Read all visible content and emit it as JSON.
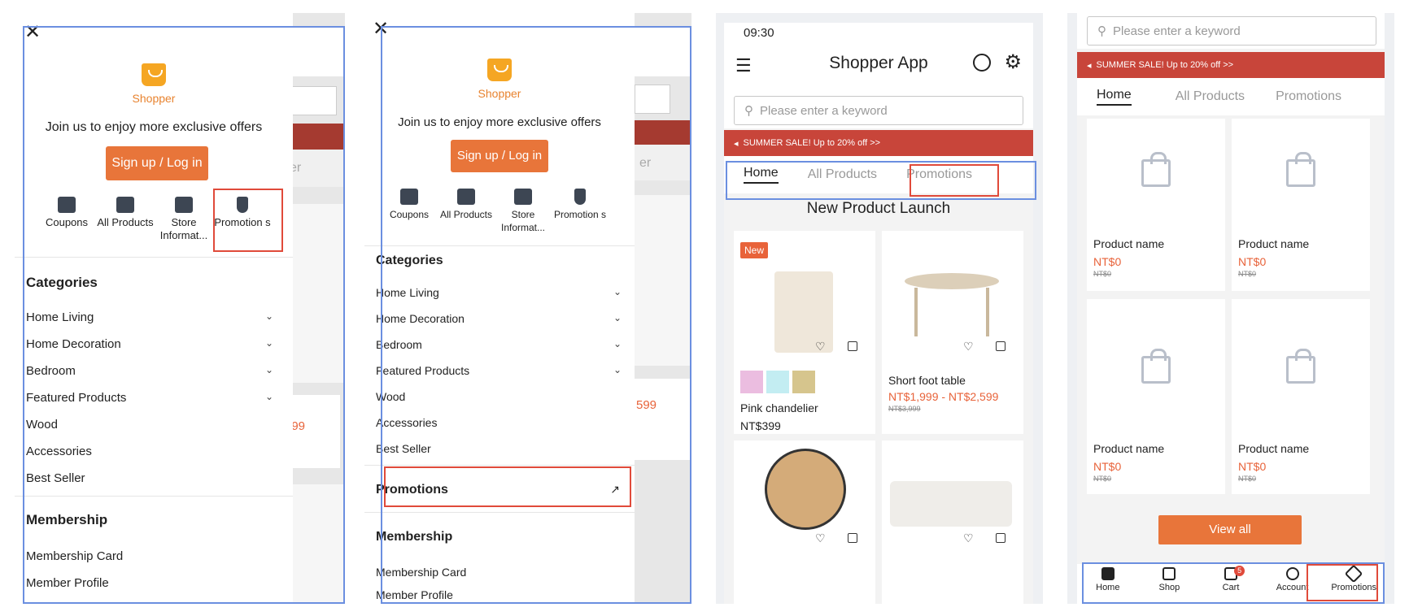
{
  "drawer": {
    "logo_text": "Shopper",
    "join_text": "Join us to enjoy more exclusive offers",
    "signup_label": "Sign up / Log in",
    "quick": [
      {
        "label": "Coupons"
      },
      {
        "label": "All Products"
      },
      {
        "label": "Store Informat..."
      },
      {
        "label": "Promotion s"
      }
    ],
    "categories_title": "Categories",
    "categories": [
      {
        "label": "Home Living",
        "expandable": true
      },
      {
        "label": "Home Decoration",
        "expandable": true
      },
      {
        "label": "Bedroom",
        "expandable": true
      },
      {
        "label": "Featured Products",
        "expandable": true
      },
      {
        "label": "Wood",
        "expandable": false
      },
      {
        "label": "Accessories",
        "expandable": false
      },
      {
        "label": "Best Seller",
        "expandable": false
      }
    ],
    "promotions_label": "Promotions",
    "membership_title": "Membership",
    "membership": [
      "Membership Card",
      "Member Profile"
    ]
  },
  "bg": {
    "price_text": "599",
    "tab_fragment": "er"
  },
  "app": {
    "time": "09:30",
    "title": "Shopper App",
    "search_placeholder": "Please enter a keyword",
    "sale_text": "SUMMER SALE! Up to 20% off >>",
    "tabs": [
      "Home",
      "All Products",
      "Promotions"
    ],
    "section_title": "New Product Launch",
    "badge_new": "New",
    "products": [
      {
        "name": "Pink chandelier",
        "price": "NT$399",
        "old_price": ""
      },
      {
        "name": "Short foot table",
        "price": "NT$1,999 - NT$2,599",
        "old_price": "NT$3,999"
      }
    ]
  },
  "promo": {
    "items": [
      {
        "name": "Product name",
        "price": "NT$0",
        "old": "NT$0"
      },
      {
        "name": "Product name",
        "price": "NT$0",
        "old": "NT$0"
      },
      {
        "name": "Product name",
        "price": "NT$0",
        "old": "NT$0"
      },
      {
        "name": "Product name",
        "price": "NT$0",
        "old": "NT$0"
      }
    ],
    "view_all": "View all",
    "bottom_nav": [
      "Home",
      "Shop",
      "Cart",
      "Account",
      "Promotions"
    ],
    "cart_count": "5"
  }
}
